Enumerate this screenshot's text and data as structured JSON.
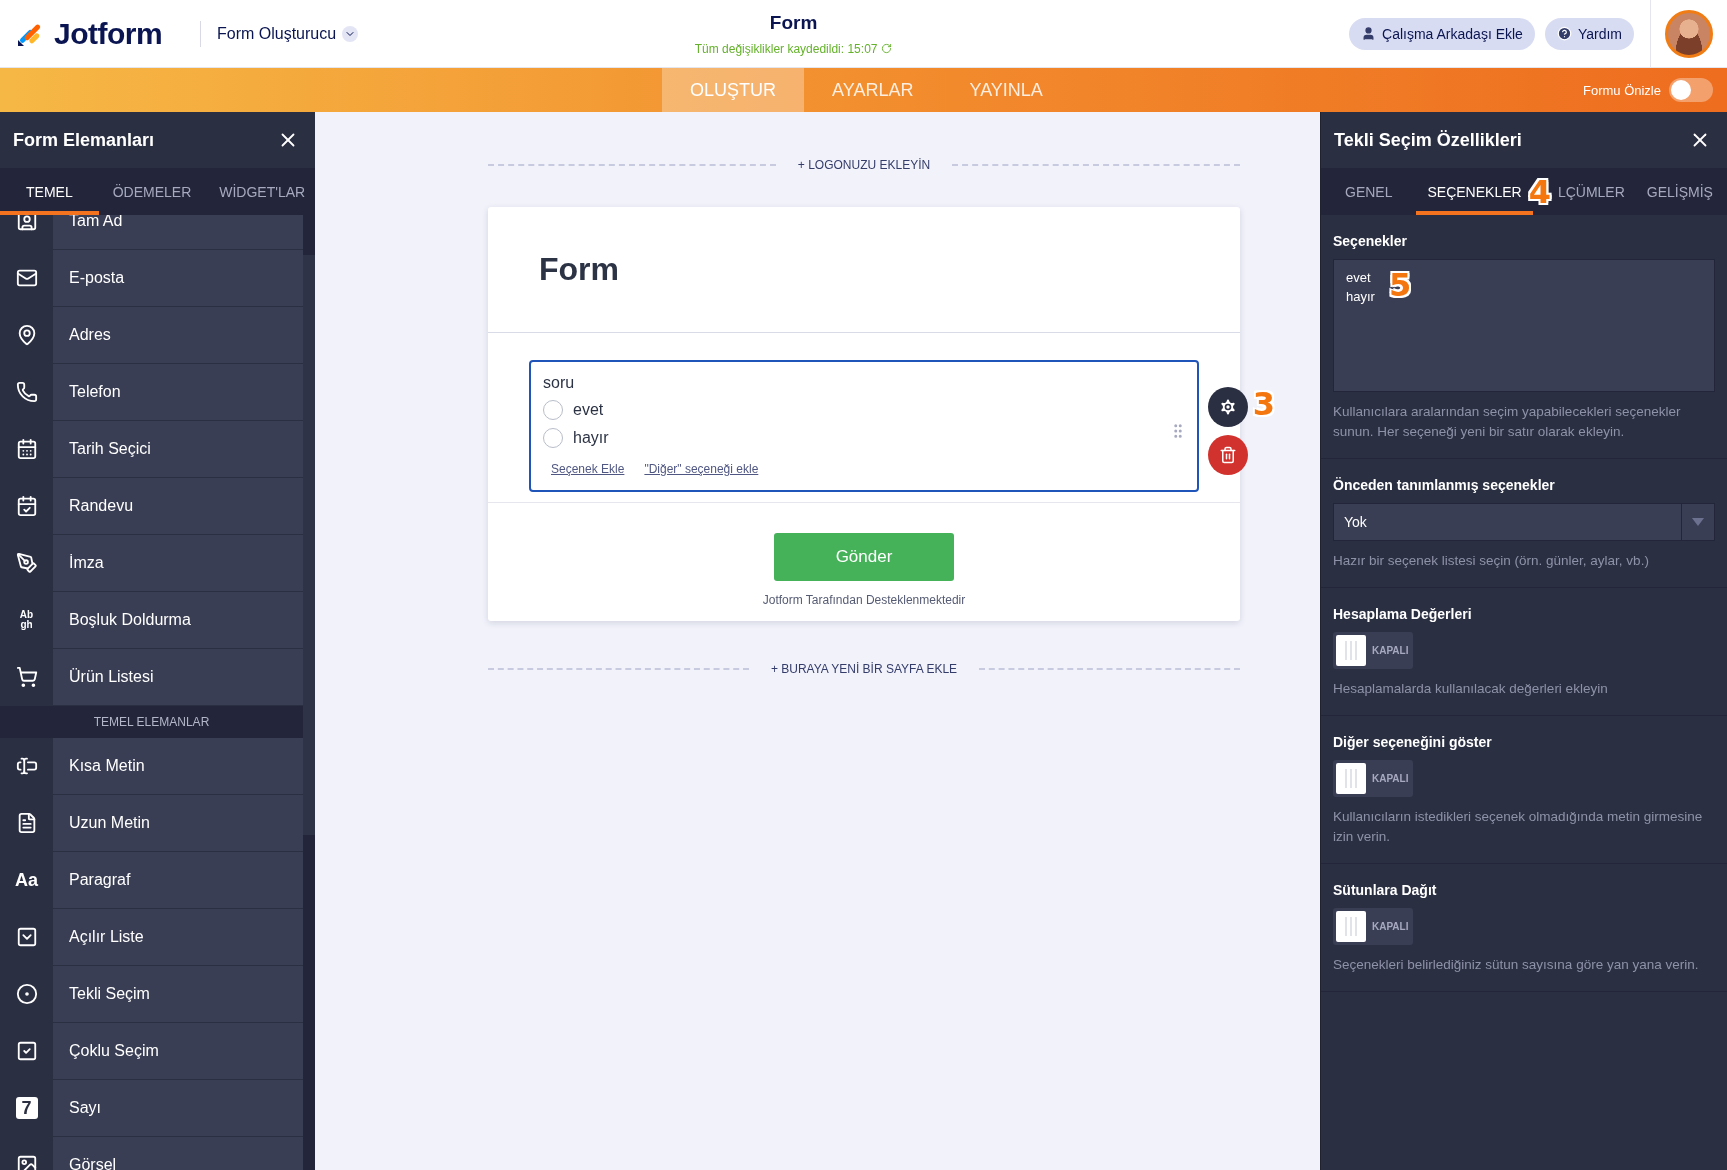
{
  "header": {
    "brand": "Jotform",
    "builder_menu": "Form Oluşturucu",
    "title": "Form",
    "save_status": "Tüm değişiklikler kaydedildi: 15:07",
    "buttons": [
      {
        "label": "Çalışma Arkadaşı Ekle",
        "kind": "person"
      },
      {
        "label": "Yardım",
        "kind": "help"
      }
    ]
  },
  "nav": {
    "tabs": [
      {
        "label": "OLUŞTUR",
        "selected": true
      },
      {
        "label": "AYARLAR",
        "selected": false
      },
      {
        "label": "YAYINLA",
        "selected": false
      }
    ],
    "preview": {
      "label": "Formu Önizle",
      "on": false
    }
  },
  "sidebar": {
    "title": "Form Elemanları",
    "tabs": [
      {
        "label": "TEMEL",
        "selected": true
      },
      {
        "label": "ÖDEMELER",
        "selected": false
      },
      {
        "label": "WİDGET'LAR",
        "selected": false
      }
    ],
    "groups": [
      {
        "items": [
          {
            "label": "Tam Ad"
          },
          {
            "label": "E-posta"
          },
          {
            "label": "Adres"
          },
          {
            "label": "Telefon"
          },
          {
            "label": "Tarih Seçici"
          },
          {
            "label": "Randevu"
          },
          {
            "label": "İmza"
          },
          {
            "label": "Boşluk Doldurma",
            "icon_text": [
              "Ab",
              "gh"
            ]
          },
          {
            "label": "Ürün Listesi"
          }
        ]
      },
      {
        "heading": "TEMEL ELEMANLAR",
        "items": [
          {
            "label": "Kısa Metin"
          },
          {
            "label": "Uzun Metin"
          },
          {
            "label": "Paragraf",
            "icon_text": [
              "Aa"
            ]
          },
          {
            "label": "Açılır Liste"
          },
          {
            "label": "Tekli Seçim"
          },
          {
            "label": "Çoklu Seçim"
          },
          {
            "label": "Sayı",
            "icon_text": [
              "7"
            ]
          },
          {
            "label": "Görsel"
          }
        ]
      }
    ]
  },
  "canvas": {
    "add_logo": "+ LOGONUZU EKLEYİN",
    "form_title": "Form",
    "question": {
      "label": "soru",
      "options": [
        {
          "label": "evet",
          "selected": false
        },
        {
          "label": "hayır",
          "selected": false
        }
      ],
      "links": [
        "Seçenek Ekle",
        "\"Diğer\" seçeneği ekle"
      ],
      "callout": "3"
    },
    "submit": "Gönder",
    "powered_by": "Jotform Tarafından Desteklenmektedir",
    "add_page": "+ BURAYA YENİ BİR SAYFA EKLE"
  },
  "properties": {
    "title": "Tekli Seçim Özellikleri",
    "tabs": [
      {
        "label": "GENEL",
        "selected": false
      },
      {
        "label": "SEÇENEKLER",
        "selected": true
      },
      {
        "label": "LÇÜMLER",
        "selected": false
      },
      {
        "label": "GELİŞMİŞ",
        "selected": false
      }
    ],
    "tab_callout": "4",
    "options": {
      "label": "Seçenekler",
      "lines": [
        "evet",
        "hayır"
      ],
      "callout": "5",
      "hint": "Kullanıcılara aralarından seçim yapabilecekleri seçenekler sunun. Her seçeneği yeni bir satır olarak ekleyin."
    },
    "predefined": {
      "label": "Önceden tanımlanmış seçenekler",
      "value": "Yok",
      "hint": "Hazır bir seçenek listesi seçin (örn. günler, aylar, vb.)"
    },
    "toggles": [
      {
        "label": "Hesaplama Değerleri",
        "state": "KAPALI",
        "on": false,
        "hint": "Hesaplamalarda kullanılacak değerleri ekleyin"
      },
      {
        "label": "Diğer seçeneğini göster",
        "state": "KAPALI",
        "on": false,
        "hint": "Kullanıcıların istedikleri seçenek olmadığında metin girmesine izin verin."
      },
      {
        "label": "Sütunlara Dağıt",
        "state": "KAPALI",
        "on": false,
        "hint": "Seçenekleri belirlediğiniz sütun sayısına göre yan yana verin."
      }
    ]
  }
}
